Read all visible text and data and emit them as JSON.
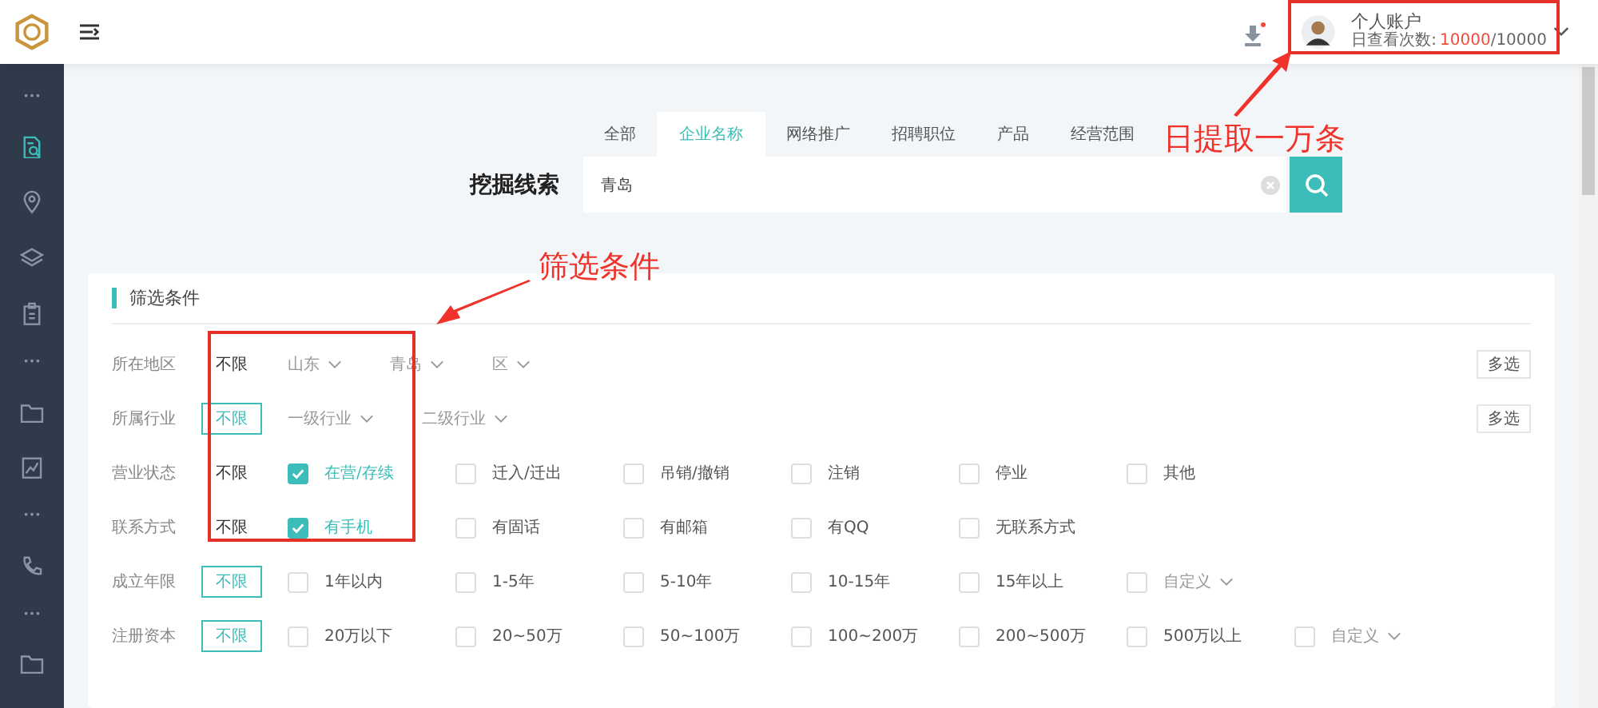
{
  "header": {
    "account": {
      "name": "个人账户",
      "quota_label": "日查看次数:",
      "used": "10000",
      "limit": "/10000"
    },
    "download_badge": true
  },
  "search": {
    "tabs": [
      {
        "label": "全部",
        "selected": false
      },
      {
        "label": "企业名称",
        "selected": true
      },
      {
        "label": "网络推广",
        "selected": false
      },
      {
        "label": "招聘职位",
        "selected": false
      },
      {
        "label": "产品",
        "selected": false
      },
      {
        "label": "经营范围",
        "selected": false
      }
    ],
    "label": "挖掘线索",
    "value": "青岛"
  },
  "filters": {
    "title": "筛选条件",
    "rows": [
      {
        "label": "所在地区",
        "unlimited": {
          "label": "不限",
          "selected": false
        },
        "multi_button": "多选",
        "options": [
          {
            "kind": "dropdown",
            "label": "山东"
          },
          {
            "kind": "dropdown",
            "label": "青岛"
          },
          {
            "kind": "dropdown",
            "label": "区"
          }
        ]
      },
      {
        "label": "所属行业",
        "unlimited": {
          "label": "不限",
          "selected": true
        },
        "multi_button": "多选",
        "options": [
          {
            "kind": "dropdown",
            "label": "一级行业"
          },
          {
            "kind": "dropdown",
            "label": "二级行业"
          }
        ]
      },
      {
        "label": "营业状态",
        "unlimited": {
          "label": "不限",
          "selected": false
        },
        "options": [
          {
            "kind": "checkbox",
            "label": "在营/存续",
            "checked": true
          },
          {
            "kind": "checkbox",
            "label": "迁入/迁出",
            "checked": false
          },
          {
            "kind": "checkbox",
            "label": "吊销/撤销",
            "checked": false
          },
          {
            "kind": "checkbox",
            "label": "注销",
            "checked": false
          },
          {
            "kind": "checkbox",
            "label": "停业",
            "checked": false
          },
          {
            "kind": "checkbox",
            "label": "其他",
            "checked": false
          }
        ]
      },
      {
        "label": "联系方式",
        "unlimited": {
          "label": "不限",
          "selected": false
        },
        "options": [
          {
            "kind": "checkbox",
            "label": "有手机",
            "checked": true
          },
          {
            "kind": "checkbox",
            "label": "有固话",
            "checked": false
          },
          {
            "kind": "checkbox",
            "label": "有邮箱",
            "checked": false
          },
          {
            "kind": "checkbox",
            "label": "有QQ",
            "checked": false
          },
          {
            "kind": "checkbox",
            "label": "无联系方式",
            "checked": false
          }
        ]
      },
      {
        "label": "成立年限",
        "unlimited": {
          "label": "不限",
          "selected": true
        },
        "options": [
          {
            "kind": "checkbox",
            "label": "1年以内",
            "checked": false
          },
          {
            "kind": "checkbox",
            "label": "1-5年",
            "checked": false
          },
          {
            "kind": "checkbox",
            "label": "5-10年",
            "checked": false
          },
          {
            "kind": "checkbox",
            "label": "10-15年",
            "checked": false
          },
          {
            "kind": "checkbox",
            "label": "15年以上",
            "checked": false
          },
          {
            "kind": "custom",
            "label": "自定义",
            "checked": false
          }
        ]
      },
      {
        "label": "注册资本",
        "unlimited": {
          "label": "不限",
          "selected": true
        },
        "options": [
          {
            "kind": "checkbox",
            "label": "20万以下",
            "checked": false
          },
          {
            "kind": "checkbox",
            "label": "20~50万",
            "checked": false
          },
          {
            "kind": "checkbox",
            "label": "50~100万",
            "checked": false
          },
          {
            "kind": "checkbox",
            "label": "100~200万",
            "checked": false
          },
          {
            "kind": "checkbox",
            "label": "200~500万",
            "checked": false
          },
          {
            "kind": "checkbox",
            "label": "500万以上",
            "checked": false
          },
          {
            "kind": "custom",
            "label": "自定义",
            "checked": false
          }
        ]
      }
    ]
  },
  "annotations": [
    {
      "kind": "account-note",
      "text": "日提取一万条"
    },
    {
      "kind": "filter-note",
      "text": "筛选条件"
    }
  ]
}
